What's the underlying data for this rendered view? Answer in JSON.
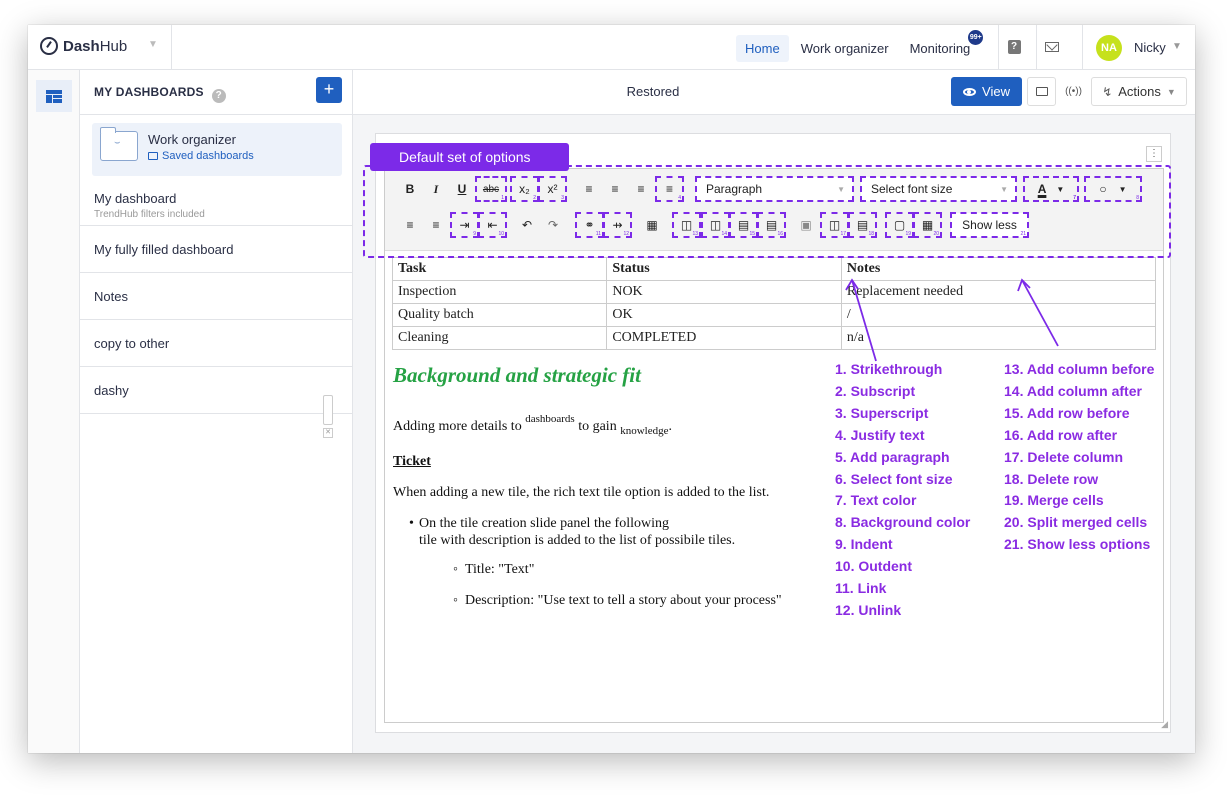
{
  "app": {
    "logo_bold": "Dash",
    "logo_rest": "Hub"
  },
  "nav": [
    {
      "label": "Home",
      "active": true
    },
    {
      "label": "Work organizer",
      "active": false
    },
    {
      "label": "Monitoring",
      "active": false,
      "badge": "99+"
    }
  ],
  "user": {
    "initials": "NA",
    "name": "Nicky",
    "avatar_color": "#c6e11c"
  },
  "sidebar": {
    "title": "MY DASHBOARDS",
    "current": {
      "name": "Work organizer",
      "sub": "Saved dashboards"
    },
    "items": [
      {
        "name": "My dashboard",
        "sub": "TrendHub filters included"
      },
      {
        "name": "My fully filled dashboard"
      },
      {
        "name": "Notes"
      },
      {
        "name": "copy to other"
      },
      {
        "name": "dashy"
      }
    ]
  },
  "main": {
    "title": "Restored",
    "view_label": "View",
    "actions_label": "Actions"
  },
  "toolbar": {
    "row1": {
      "bold": "B",
      "italic": "I",
      "underline": "U",
      "strike": "abc",
      "sub": "x₂",
      "sup": "x²",
      "paragraph": "Paragraph",
      "font_size": "Select font size",
      "text_color": "A",
      "bg_color": "○"
    },
    "show_less": "Show less"
  },
  "table": {
    "headers": [
      "Task",
      "Status",
      "Notes"
    ],
    "rows": [
      [
        "Inspection",
        "NOK",
        "Replacement needed"
      ],
      [
        "Quality batch",
        "OK",
        "/"
      ],
      [
        "Cleaning",
        "COMPLETED",
        "n/a"
      ]
    ]
  },
  "doc": {
    "heading": "Background and strategic fit",
    "line1_a": "Adding more details to ",
    "line1_sup": "dashboards",
    "line1_b": " to gain ",
    "line1_sub": "knowledge",
    "line1_c": ".",
    "ticket": "Ticket",
    "ticket_line": "When adding a new tile, the rich text tile option is added to the list.",
    "bullet1_a": "On the tile creation slide panel the following",
    "bullet1_b": "tile with description is added to the list of possibile tiles.",
    "sub1": "Title: \"Text\"",
    "sub2": "Description: \"Use text to tell a story about your process\""
  },
  "annotation": {
    "callout": "Default set of options",
    "color": "#7c2ae8",
    "legend_left": [
      "1. Strikethrough",
      "2. Subscript",
      "3. Superscript",
      "4. Justify text",
      "5. Add paragraph",
      "6. Select font size",
      "7. Text color",
      "8. Background color",
      "9. Indent",
      "10. Outdent",
      "11. Link",
      "12. Unlink"
    ],
    "legend_right": [
      "13. Add column before",
      "14. Add column after",
      "15. Add row before",
      "16. Add row after",
      "17. Delete column",
      "18. Delete row",
      "19. Merge cells",
      "20. Split merged cells",
      "21. Show less options"
    ]
  }
}
